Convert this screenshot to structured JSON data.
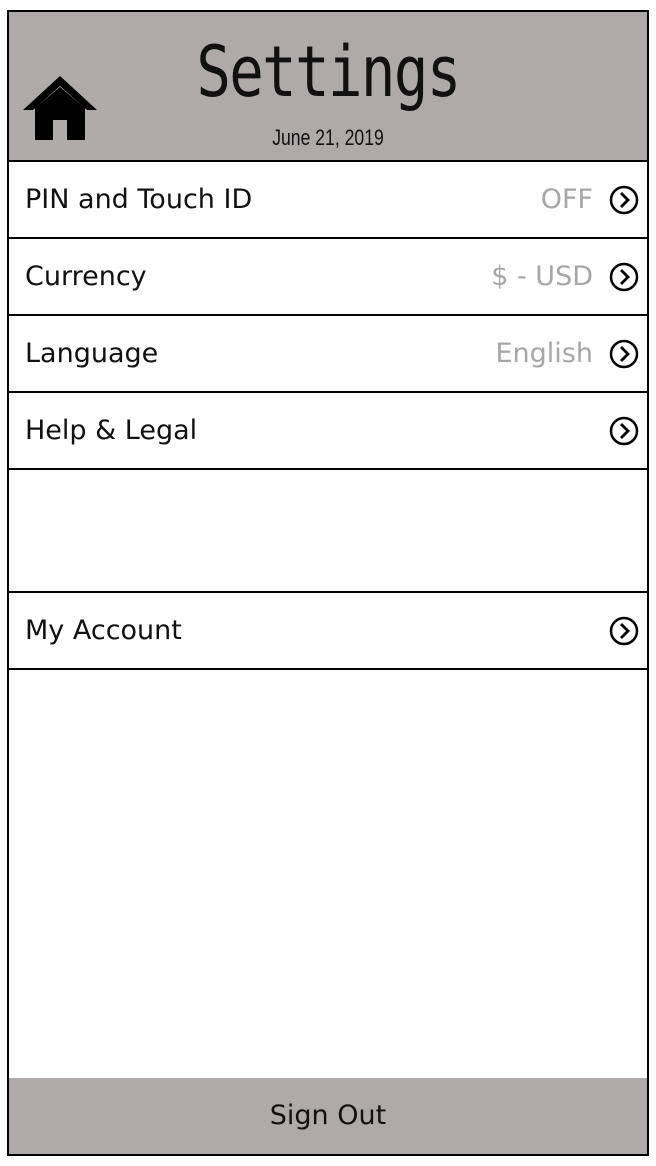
{
  "header": {
    "title": "Settings",
    "date": "June 21, 2019",
    "home_icon": "home-icon"
  },
  "settings": {
    "items": [
      {
        "label": "PIN and Touch ID",
        "value": "OFF",
        "icon": "chevron-right-circle-icon"
      },
      {
        "label": "Currency",
        "value": "$ - USD",
        "icon": "chevron-right-circle-icon"
      },
      {
        "label": "Language",
        "value": "English",
        "icon": "chevron-right-circle-icon"
      },
      {
        "label": "Help & Legal",
        "value": "",
        "icon": "chevron-right-circle-icon"
      }
    ],
    "account": {
      "label": "My Account",
      "icon": "chevron-right-circle-icon"
    }
  },
  "footer": {
    "sign_out_label": "Sign Out"
  },
  "colors": {
    "header_bg": "#aeaaaa",
    "value_text": "#a6a6a6",
    "border": "#000000"
  }
}
